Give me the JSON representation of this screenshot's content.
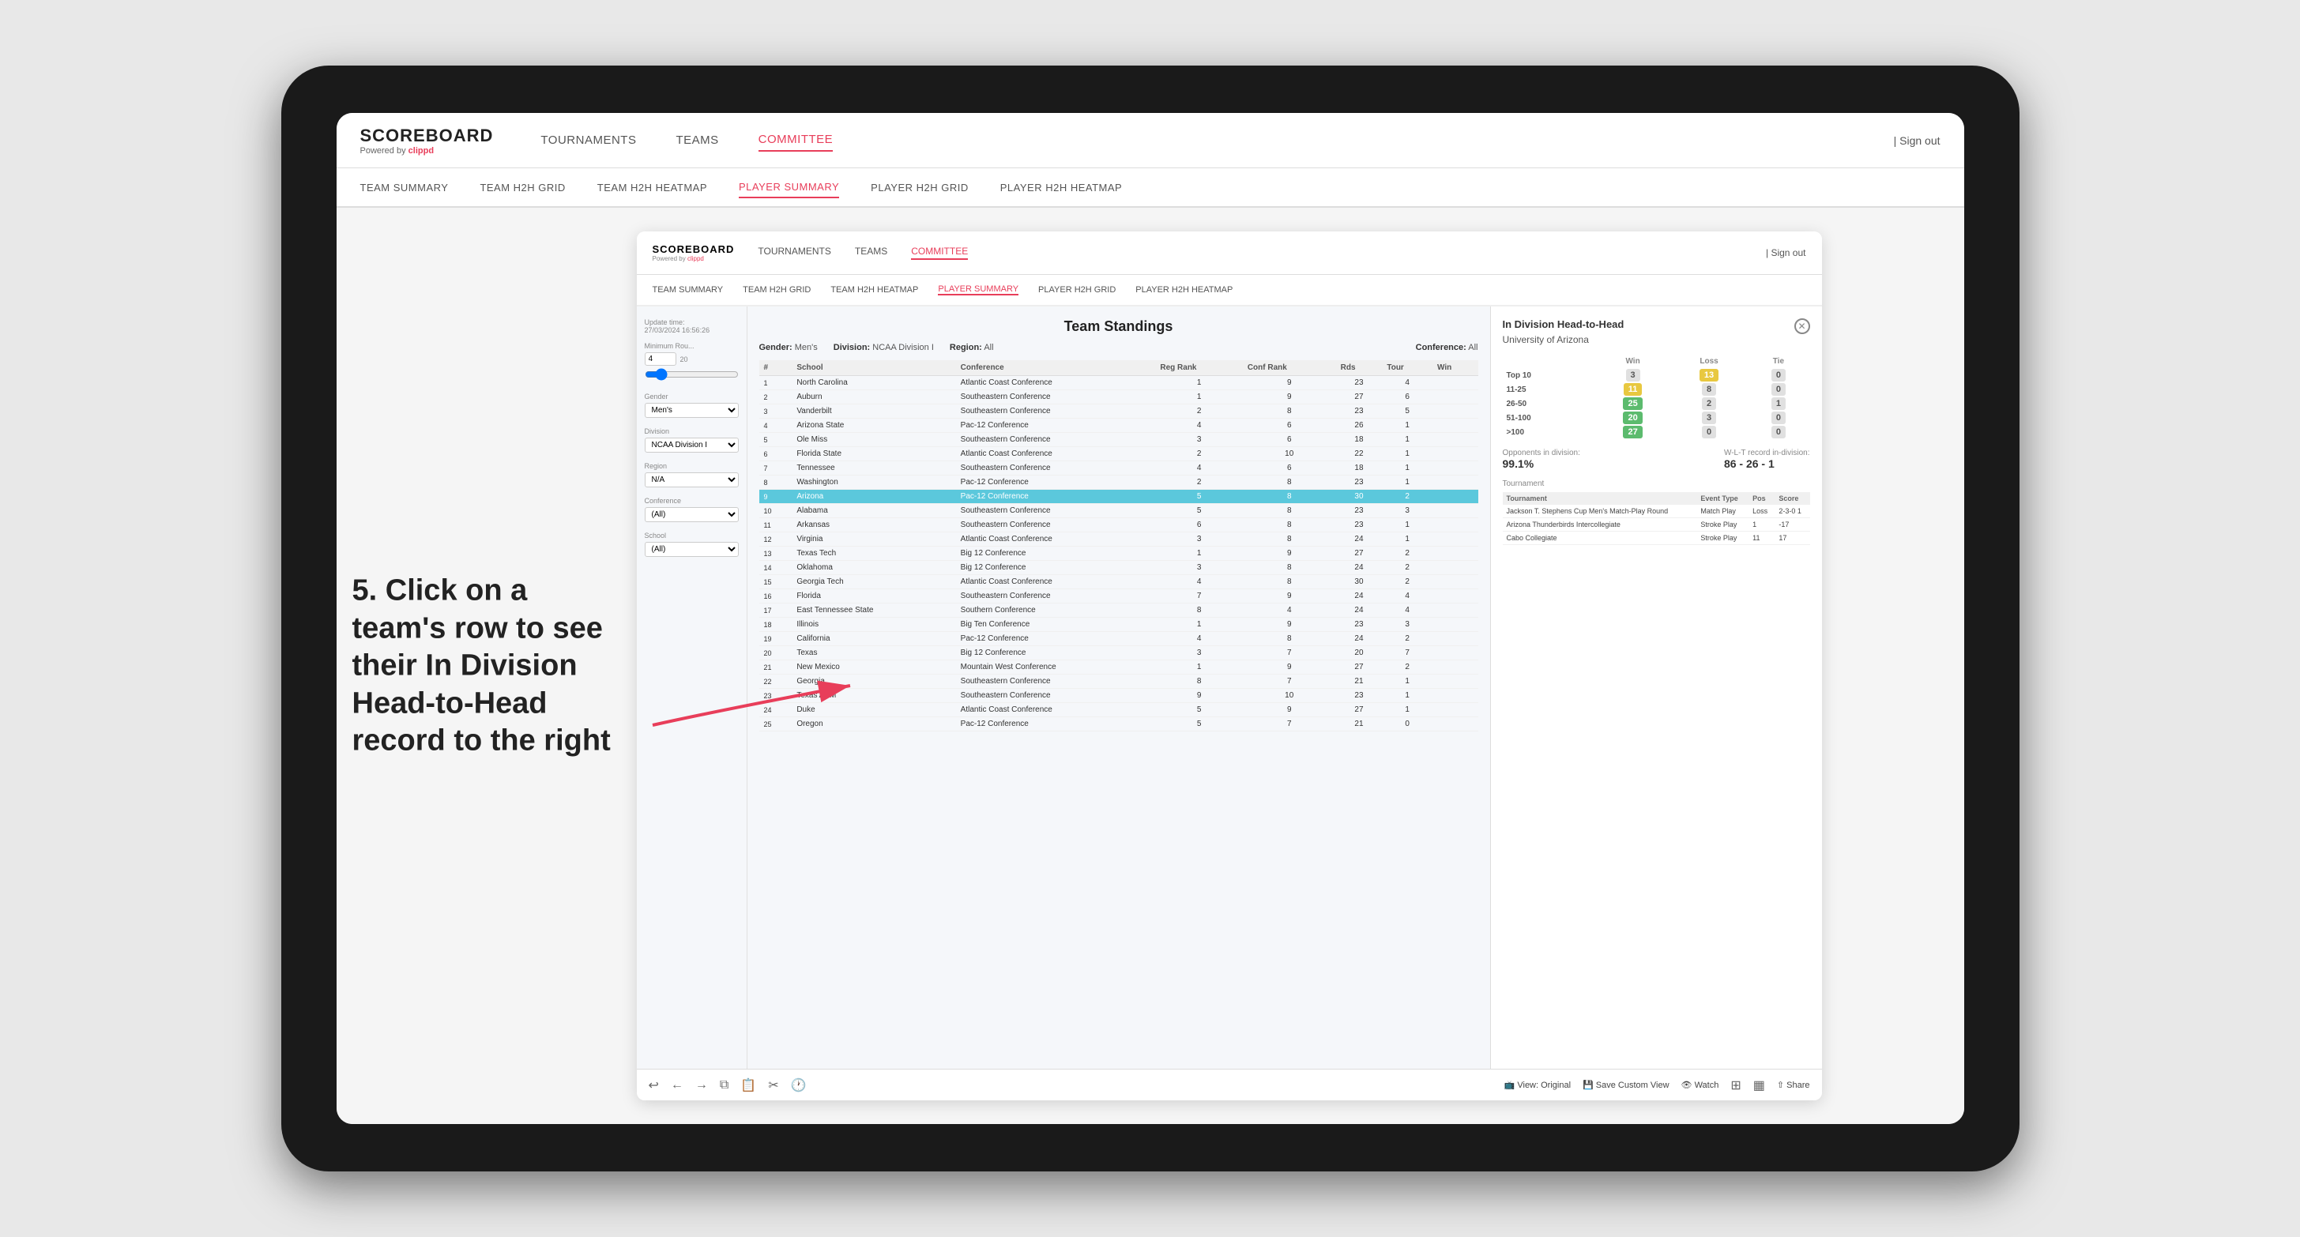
{
  "tablet": {
    "annotation": "5. Click on a team's row to see their In Division Head-to-Head record to the right"
  },
  "app": {
    "logo": "SCOREBOARD",
    "logo_sub": "Powered by clippd",
    "nav": {
      "items": [
        "TOURNAMENTS",
        "TEAMS",
        "COMMITTEE"
      ],
      "active": "COMMITTEE"
    },
    "sign_out": "Sign out",
    "sub_nav": {
      "items": [
        "TEAM SUMMARY",
        "TEAM H2H GRID",
        "TEAM H2H HEATMAP",
        "PLAYER SUMMARY",
        "PLAYER H2H GRID",
        "PLAYER H2H HEATMAP"
      ],
      "active": "PLAYER SUMMARY"
    }
  },
  "filter_panel": {
    "update_time_label": "Update time:",
    "update_time": "27/03/2024 16:56:26",
    "min_rou_label": "Minimum Rou...",
    "min_rou_value": "4",
    "min_rou_max": "20",
    "gender_label": "Gender",
    "gender_value": "Men's",
    "division_label": "Division",
    "division_value": "NCAA Division I",
    "region_label": "Region",
    "region_value": "N/A",
    "conference_label": "Conference",
    "conference_value": "(All)",
    "school_label": "School",
    "school_value": "(All)"
  },
  "standings": {
    "title": "Team Standings",
    "gender_label": "Gender:",
    "gender_value": "Men's",
    "division_label": "Division:",
    "division_value": "NCAA Division I",
    "region_label": "Region:",
    "region_value": "All",
    "conference_label": "Conference:",
    "conference_value": "All",
    "columns": [
      "#",
      "School",
      "Conference",
      "Reg Rank",
      "Conf Rank",
      "Rds",
      "Tour",
      "Win"
    ],
    "rows": [
      {
        "rank": 1,
        "school": "North Carolina",
        "conference": "Atlantic Coast Conference",
        "reg_rank": 1,
        "conf_rank": 9,
        "rds": 23,
        "tour": 4,
        "win": ""
      },
      {
        "rank": 2,
        "school": "Auburn",
        "conference": "Southeastern Conference",
        "reg_rank": 1,
        "conf_rank": 9,
        "rds": 27,
        "tour": 6,
        "win": ""
      },
      {
        "rank": 3,
        "school": "Vanderbilt",
        "conference": "Southeastern Conference",
        "reg_rank": 2,
        "conf_rank": 8,
        "rds": 23,
        "tour": 5,
        "win": ""
      },
      {
        "rank": 4,
        "school": "Arizona State",
        "conference": "Pac-12 Conference",
        "reg_rank": 4,
        "conf_rank": 6,
        "rds": 26,
        "tour": 1,
        "win": ""
      },
      {
        "rank": 5,
        "school": "Ole Miss",
        "conference": "Southeastern Conference",
        "reg_rank": 3,
        "conf_rank": 6,
        "rds": 18,
        "tour": 1,
        "win": ""
      },
      {
        "rank": 6,
        "school": "Florida State",
        "conference": "Atlantic Coast Conference",
        "reg_rank": 2,
        "conf_rank": 10,
        "rds": 22,
        "tour": 1,
        "win": ""
      },
      {
        "rank": 7,
        "school": "Tennessee",
        "conference": "Southeastern Conference",
        "reg_rank": 4,
        "conf_rank": 6,
        "rds": 18,
        "tour": 1,
        "win": ""
      },
      {
        "rank": 8,
        "school": "Washington",
        "conference": "Pac-12 Conference",
        "reg_rank": 2,
        "conf_rank": 8,
        "rds": 23,
        "tour": 1,
        "win": ""
      },
      {
        "rank": 9,
        "school": "Arizona",
        "conference": "Pac-12 Conference",
        "reg_rank": 5,
        "conf_rank": 8,
        "rds": 30,
        "tour": 2,
        "win": "",
        "selected": true
      },
      {
        "rank": 10,
        "school": "Alabama",
        "conference": "Southeastern Conference",
        "reg_rank": 5,
        "conf_rank": 8,
        "rds": 23,
        "tour": 3,
        "win": ""
      },
      {
        "rank": 11,
        "school": "Arkansas",
        "conference": "Southeastern Conference",
        "reg_rank": 6,
        "conf_rank": 8,
        "rds": 23,
        "tour": 1,
        "win": ""
      },
      {
        "rank": 12,
        "school": "Virginia",
        "conference": "Atlantic Coast Conference",
        "reg_rank": 3,
        "conf_rank": 8,
        "rds": 24,
        "tour": 1,
        "win": ""
      },
      {
        "rank": 13,
        "school": "Texas Tech",
        "conference": "Big 12 Conference",
        "reg_rank": 1,
        "conf_rank": 9,
        "rds": 27,
        "tour": 2,
        "win": ""
      },
      {
        "rank": 14,
        "school": "Oklahoma",
        "conference": "Big 12 Conference",
        "reg_rank": 3,
        "conf_rank": 8,
        "rds": 24,
        "tour": 2,
        "win": ""
      },
      {
        "rank": 15,
        "school": "Georgia Tech",
        "conference": "Atlantic Coast Conference",
        "reg_rank": 4,
        "conf_rank": 8,
        "rds": 30,
        "tour": 2,
        "win": ""
      },
      {
        "rank": 16,
        "school": "Florida",
        "conference": "Southeastern Conference",
        "reg_rank": 7,
        "conf_rank": 9,
        "rds": 24,
        "tour": 4,
        "win": ""
      },
      {
        "rank": 17,
        "school": "East Tennessee State",
        "conference": "Southern Conference",
        "reg_rank": 8,
        "conf_rank": 4,
        "rds": 24,
        "tour": 4,
        "win": ""
      },
      {
        "rank": 18,
        "school": "Illinois",
        "conference": "Big Ten Conference",
        "reg_rank": 1,
        "conf_rank": 9,
        "rds": 23,
        "tour": 3,
        "win": ""
      },
      {
        "rank": 19,
        "school": "California",
        "conference": "Pac-12 Conference",
        "reg_rank": 4,
        "conf_rank": 8,
        "rds": 24,
        "tour": 2,
        "win": ""
      },
      {
        "rank": 20,
        "school": "Texas",
        "conference": "Big 12 Conference",
        "reg_rank": 3,
        "conf_rank": 7,
        "rds": 20,
        "tour": 7,
        "win": ""
      },
      {
        "rank": 21,
        "school": "New Mexico",
        "conference": "Mountain West Conference",
        "reg_rank": 1,
        "conf_rank": 9,
        "rds": 27,
        "tour": 2,
        "win": ""
      },
      {
        "rank": 22,
        "school": "Georgia",
        "conference": "Southeastern Conference",
        "reg_rank": 8,
        "conf_rank": 7,
        "rds": 21,
        "tour": 1,
        "win": ""
      },
      {
        "rank": 23,
        "school": "Texas A&M",
        "conference": "Southeastern Conference",
        "reg_rank": 9,
        "conf_rank": 10,
        "rds": 23,
        "tour": 1,
        "win": ""
      },
      {
        "rank": 24,
        "school": "Duke",
        "conference": "Atlantic Coast Conference",
        "reg_rank": 5,
        "conf_rank": 9,
        "rds": 27,
        "tour": 1,
        "win": ""
      },
      {
        "rank": 25,
        "school": "Oregon",
        "conference": "Pac-12 Conference",
        "reg_rank": 5,
        "conf_rank": 7,
        "rds": 21,
        "tour": 0,
        "win": ""
      }
    ]
  },
  "h2h": {
    "title": "In Division Head-to-Head",
    "team": "University of Arizona",
    "categories": [
      "Win",
      "Loss",
      "Tie"
    ],
    "rows": [
      {
        "label": "Top 10",
        "win": 3,
        "loss": 13,
        "tie": 0
      },
      {
        "label": "11-25",
        "win": 11,
        "loss": 8,
        "tie": 0
      },
      {
        "label": "26-50",
        "win": 25,
        "loss": 2,
        "tie": 1
      },
      {
        "label": "51-100",
        "win": 20,
        "loss": 3,
        "tie": 0
      },
      {
        "label": ">100",
        "win": 27,
        "loss": 0,
        "tie": 0
      }
    ],
    "opponents_label": "Opponents in division:",
    "opponents_value": "99.1%",
    "wlt_label": "W-L-T record in-division:",
    "wlt_value": "86 - 26 - 1",
    "tournaments": [
      {
        "name": "Jackson T. Stephens Cup Men's Match-Play Round",
        "event_type": "Match Play",
        "pos": "Loss",
        "score": "2-3-0 1"
      },
      {
        "name": "Arizona Thunderbirds Intercollegiate",
        "event_type": "Stroke Play",
        "pos": "1",
        "score": "-17"
      },
      {
        "name": "Cabo Collegiate",
        "event_type": "Stroke Play",
        "pos": "11",
        "score": "17"
      }
    ],
    "tournament_cols": [
      "Tournament",
      "Event Type",
      "Pos",
      "Score"
    ]
  },
  "toolbar": {
    "undo": "↩",
    "redo_back": "←",
    "redo_fwd": "→",
    "view_original": "View: Original",
    "save_custom": "Save Custom View",
    "watch": "Watch",
    "share": "Share"
  }
}
